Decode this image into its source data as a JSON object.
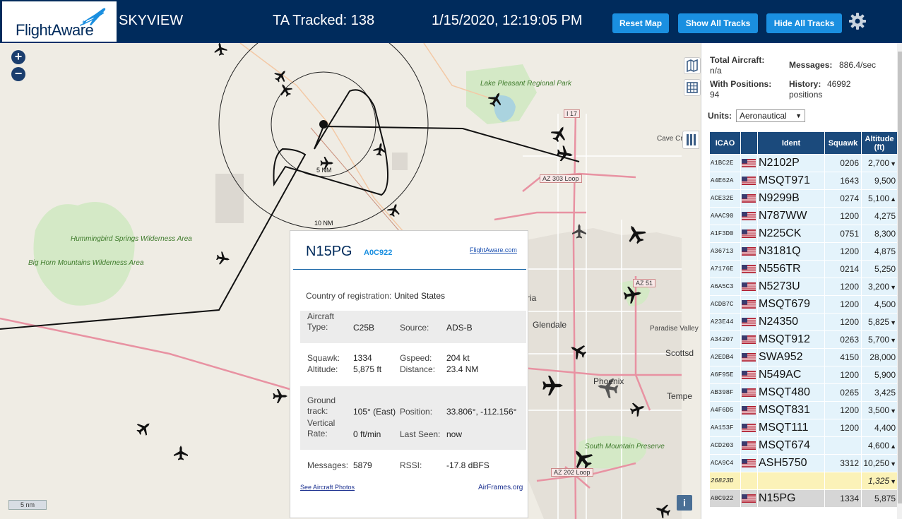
{
  "header": {
    "logo_text": "FlightAware",
    "app_name": "SKYVIEW",
    "ta_tracked": "TA Tracked: 138",
    "datetime": "1/15/2020, 12:19:05 PM",
    "reset_map": "Reset Map",
    "show_all_tracks": "Show All Tracks",
    "hide_all_tracks": "Hide All Tracks",
    "settings_icon": "gear-icon"
  },
  "map": {
    "zoom_in": "+",
    "zoom_out": "−",
    "scale_label": "5 nm",
    "info_label": "i",
    "range_rings": [
      "5 NM",
      "10 NM"
    ],
    "places": {
      "lake_pleasant": "Lake Pleasant Regional Park",
      "hummingbird": "Hummingbird Springs Wilderness Area",
      "big_horn": "Big Horn Mountains Wilderness Area",
      "south_mountain": "South Mountain Preserve",
      "cave_creek": "Cave Cr",
      "glendale": "Glendale",
      "phoenix": "Phoenix",
      "scottsdale": "Scottsd",
      "tempe": "Tempe",
      "paradise_valley": "Paradise Valley",
      "peoria_fragment": "ria"
    },
    "roads": [
      "I 17",
      "AZ 303 Loop",
      "AZ 51",
      "AZ 202 Loop"
    ],
    "colors": {
      "land": "#efece4",
      "park": "#d4e9c6",
      "water": "#aad3df",
      "highway": "#e892a2",
      "urban": "#e0dcd6"
    }
  },
  "popup": {
    "ident": "N15PG",
    "icao": "A0C922",
    "fa_link": "FlightAware.com",
    "country_label": "Country of registration:",
    "country_value": "United States",
    "aircraft_type_label": "Aircraft Type:",
    "aircraft_type_value": "C25B",
    "source_label": "Source:",
    "source_value": "ADS-B",
    "squawk_label": "Squawk:",
    "squawk_value": "1334",
    "altitude_label": "Altitude:",
    "altitude_value": "5,875 ft",
    "gspeed_label": "Gspeed:",
    "gspeed_value": "204 kt",
    "distance_label": "Distance:",
    "distance_value": "23.4 NM",
    "ground_track_label": "Ground track:",
    "ground_track_value": "105° (East)",
    "position_label": "Position:",
    "position_value": "33.806°, -112.156°",
    "vertical_rate_label": "Vertical Rate:",
    "vertical_rate_value": "0 ft/min",
    "last_seen_label": "Last Seen:",
    "last_seen_value": "now",
    "messages_label": "Messages:",
    "messages_value": "5879",
    "rssi_label": "RSSI:",
    "rssi_value": "-17.8 dBFS",
    "photos_link": "See Aircraft Photos",
    "airframes_link": "AirFrames.org"
  },
  "sidebar": {
    "total_aircraft_label": "Total Aircraft:",
    "total_aircraft_value": "n/a",
    "messages_label": "Messages:",
    "messages_value": "886.4/sec",
    "with_positions_label": "With Positions:",
    "with_positions_value": "94",
    "history_label": "History:",
    "history_value": "46992",
    "history_unit": "positions",
    "units_label": "Units:",
    "units_value": "Aeronautical",
    "columns": [
      "ICAO",
      "",
      "Ident",
      "Squawk",
      "Altitude (ft)"
    ],
    "rows": [
      {
        "icao": "A1BC2E",
        "ident": "N2102P",
        "squawk": "0206",
        "altitude": "2,700",
        "trend": "▼"
      },
      {
        "icao": "A4E62A",
        "ident": "MSQT971",
        "squawk": "1643",
        "altitude": "9,500",
        "trend": ""
      },
      {
        "icao": "ACE32E",
        "ident": "N9299B",
        "squawk": "0274",
        "altitude": "5,100",
        "trend": "▲"
      },
      {
        "icao": "AAAC90",
        "ident": "N787WW",
        "squawk": "1200",
        "altitude": "4,275",
        "trend": ""
      },
      {
        "icao": "A1F3D0",
        "ident": "N225CK",
        "squawk": "0751",
        "altitude": "8,300",
        "trend": ""
      },
      {
        "icao": "A36713",
        "ident": "N3181Q",
        "squawk": "1200",
        "altitude": "4,875",
        "trend": ""
      },
      {
        "icao": "A7176E",
        "ident": "N556TR",
        "squawk": "0214",
        "altitude": "5,250",
        "trend": ""
      },
      {
        "icao": "A6A5C3",
        "ident": "N5273U",
        "squawk": "1200",
        "altitude": "3,200",
        "trend": "▼"
      },
      {
        "icao": "ACDB7C",
        "ident": "MSQT679",
        "squawk": "1200",
        "altitude": "4,500",
        "trend": ""
      },
      {
        "icao": "A23E44",
        "ident": "N24350",
        "squawk": "1200",
        "altitude": "5,825",
        "trend": "▼"
      },
      {
        "icao": "A34207",
        "ident": "MSQT912",
        "squawk": "0263",
        "altitude": "5,700",
        "trend": "▼"
      },
      {
        "icao": "A2EDB4",
        "ident": "SWA952",
        "squawk": "4150",
        "altitude": "28,000",
        "trend": ""
      },
      {
        "icao": "A6F95E",
        "ident": "N549AC",
        "squawk": "1200",
        "altitude": "5,900",
        "trend": ""
      },
      {
        "icao": "AB398F",
        "ident": "MSQT480",
        "squawk": "0265",
        "altitude": "3,425",
        "trend": ""
      },
      {
        "icao": "A4F6D5",
        "ident": "MSQT831",
        "squawk": "1200",
        "altitude": "3,500",
        "trend": "▼"
      },
      {
        "icao": "AA153F",
        "ident": "MSQT111",
        "squawk": "1200",
        "altitude": "4,400",
        "trend": ""
      },
      {
        "icao": "ACD203",
        "ident": "MSQT674",
        "squawk": "",
        "altitude": "4,600",
        "trend": "▲"
      },
      {
        "icao": "ACA9C4",
        "ident": "ASH5750",
        "squawk": "3312",
        "altitude": "10,250",
        "trend": "▼"
      },
      {
        "icao": "26823D",
        "ident": "",
        "squawk": "",
        "altitude": "1,325",
        "trend": "▼",
        "state": "highlight",
        "flag": false
      },
      {
        "icao": "A0C922",
        "ident": "N15PG",
        "squawk": "1334",
        "altitude": "5,875",
        "trend": "",
        "state": "selected"
      }
    ]
  }
}
